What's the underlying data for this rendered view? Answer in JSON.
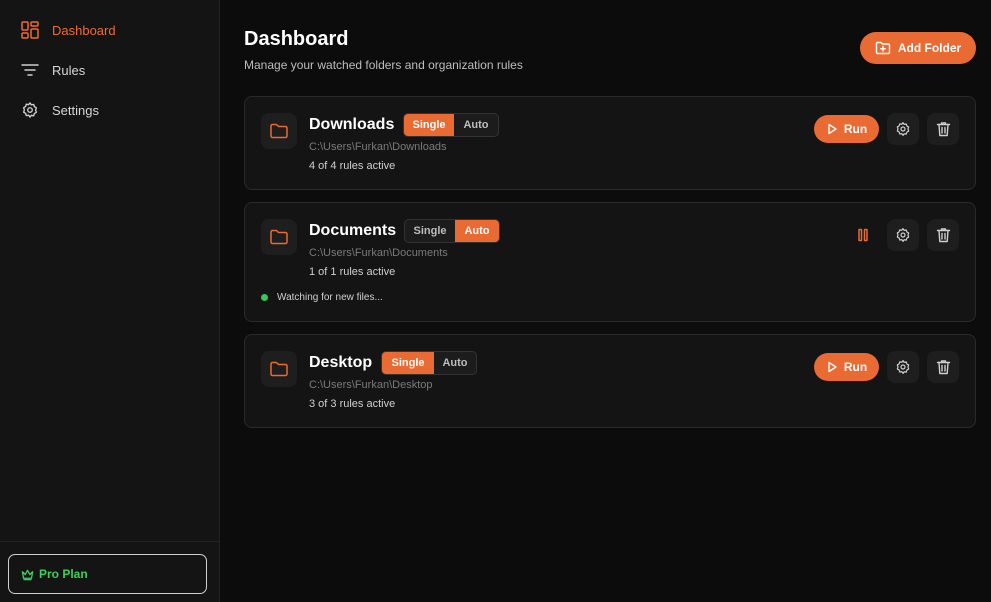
{
  "sidebar": {
    "items": [
      {
        "label": "Dashboard",
        "icon": "dashboard-icon",
        "active": true
      },
      {
        "label": "Rules",
        "icon": "filter-icon",
        "active": false
      },
      {
        "label": "Settings",
        "icon": "gear-icon",
        "active": false
      }
    ],
    "plan_label": "Pro Plan"
  },
  "header": {
    "title": "Dashboard",
    "subtitle": "Manage your watched folders and organization rules",
    "add_folder_label": "Add Folder"
  },
  "toggle_labels": {
    "single": "Single",
    "auto": "Auto"
  },
  "folders": [
    {
      "name": "Downloads",
      "path": "C:\\Users\\Furkan\\Downloads",
      "rules": "4 of 4 rules active",
      "mode": "Single",
      "run_label": "Run"
    },
    {
      "name": "Documents",
      "path": "C:\\Users\\Furkan\\Documents",
      "rules": "1 of 1 rules active",
      "mode": "Auto",
      "status": "Watching for new files..."
    },
    {
      "name": "Desktop",
      "path": "C:\\Users\\Furkan\\Desktop",
      "rules": "3 of 3 rules active",
      "mode": "Single",
      "run_label": "Run"
    }
  ],
  "colors": {
    "accent": "#ea6a34",
    "active_nav": "#f06a35",
    "status_green": "#35c759",
    "plan_green": "#3ecf5a"
  }
}
